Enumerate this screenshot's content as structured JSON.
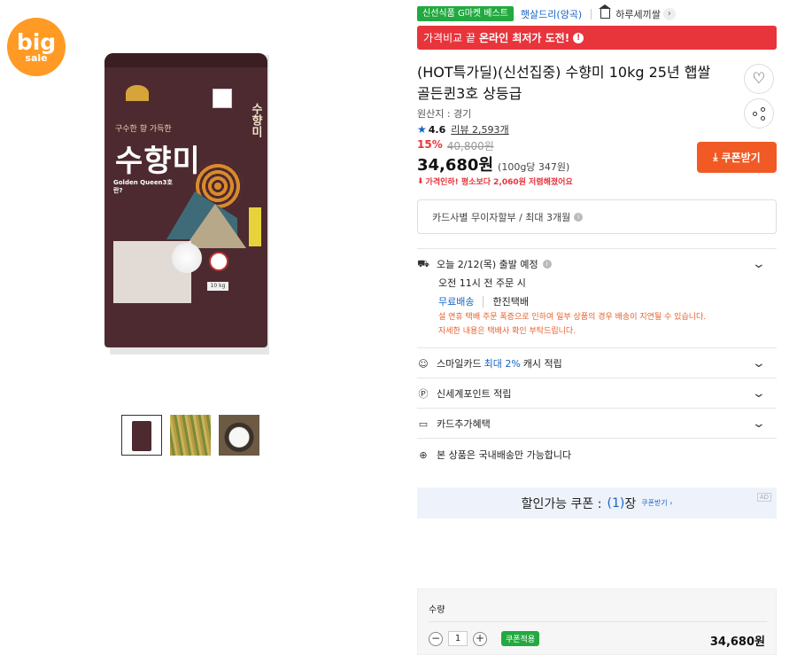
{
  "badge": {
    "line1": "big",
    "line2": "sale"
  },
  "product_image": {
    "brand_text": "수향미",
    "slogan": "구수한 향 가득한",
    "side_text": "수향미",
    "golden_queen": "Golden Queen3호란?",
    "weight": "10 kg"
  },
  "tags": {
    "category": "신선식품 G마켓 베스트",
    "seller": "햇살드리(양곡)",
    "shop": "하루세끼쌀"
  },
  "banner": {
    "prefix": "가격비교 끝",
    "bold": "온라인 최저가 도전!"
  },
  "title": "(HOT특가딜)(신선집중) 수향미 10kg 25년 햅쌀 골든퀸3호 상등급",
  "origin": "원산지 : 경기",
  "rating": {
    "score": "4.6",
    "review_label": "리뷰 2,593개"
  },
  "price": {
    "discount_pct": "15%",
    "original": "40,800원",
    "current": "34,680원",
    "per_unit": "(100g당 347원)",
    "lowest_note": "가격인하! 평소보다 2,060원 저렴해졌어요"
  },
  "coupon_button": "쿠폰받기",
  "card_installment": "카드사별 무이자할부 / 최대 3개월",
  "shipping": {
    "title": "오늘 2/12(목) 출발 예정",
    "cutoff": "오전 11시 전 주문 시",
    "free": "무료배송",
    "courier": "한진택배",
    "notice_line1": "설 연휴 택배 주문 폭증으로 인하여 일부 상품의 경우 배송이 지연될 수 있습니다.",
    "notice_line2": "자세한 내용은 택배사 확인 부탁드립니다."
  },
  "benefits": {
    "smile_prefix": "스마일카드",
    "smile_highlight": "최대 2%",
    "smile_suffix": "캐시 적립",
    "shinsegae": "신세계포인트 적립",
    "card_extra": "카드추가혜택",
    "domestic": "본 상품은 국내배송만 가능합니다"
  },
  "coupon_bar": {
    "label": "할인가능 쿠폰 :",
    "count": "(1)",
    "suffix": "장",
    "get": "쿠폰받기 ›",
    "ad": "AD"
  },
  "quantity": {
    "label": "수량",
    "value": "1",
    "apply": "쿠폰적용",
    "total": "34,680원"
  },
  "colors": {
    "accent_red": "#e8343b",
    "coupon_orange": "#f15a24",
    "green": "#22a940",
    "blue": "#1663c7"
  }
}
